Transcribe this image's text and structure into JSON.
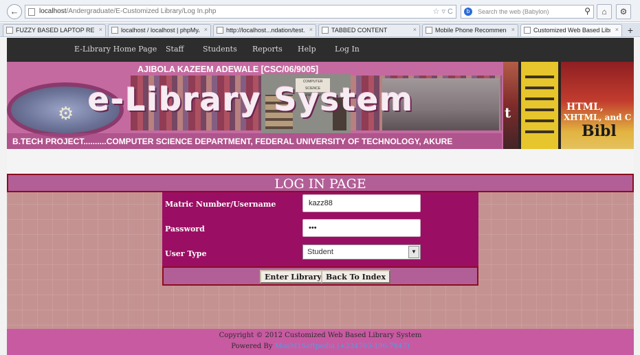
{
  "browser": {
    "url_host": "localhost",
    "url_path": "/Andergraduate/E-Customized Library/Log In.php",
    "search_placeholder": "Search the web (Babylon)",
    "addr_icons": "☆ ▿ C",
    "tabs": [
      {
        "title": "FUZZY BASED LAPTOP RECOMM...",
        "active": false
      },
      {
        "title": "localhost / localhost | phpMyAd...",
        "active": false
      },
      {
        "title": "http://localhost...ndation/test.php",
        "active": false
      },
      {
        "title": "TABBED CONTENT",
        "active": false
      },
      {
        "title": "Mobile Phone Recommender Sys...",
        "active": false
      },
      {
        "title": "Customized Web Based Library ...",
        "active": true
      }
    ],
    "new_tab_label": "+",
    "tab_close_glyph": "×"
  },
  "nav": {
    "items": [
      "E-Library Home Page",
      "Staff",
      "Students",
      "Reports",
      "Help",
      "Log In"
    ]
  },
  "banner": {
    "names": "AJIBOLA      KAZEEM      ADEWALE          [CSC/06/9005]",
    "title": "e-Library System",
    "subtitle": "B.TECH PROJECT..........COMPUTER SCIENCE DEPARTMENT, FEDERAL UNIVERSITY OF TECHNOLOGY, AKURE",
    "sign_text": "COMPUTER SCIENCE DEPARTMENT",
    "book_letter": "t",
    "book_html": "HTML,",
    "book_xhtml": "XHTML, and C",
    "book_bible": "Bibl"
  },
  "login": {
    "heading": "LOG IN PAGE",
    "username_label": "Matric Number/Username",
    "username_value": "kazz88",
    "password_label": "Password",
    "password_value": "•••",
    "usertype_label": "User Type",
    "usertype_value": "Student",
    "enter_button": "Enter Library",
    "back_button": "Back To Index"
  },
  "footer": {
    "copyright": "Copyright © 2012 Customized Web Based Library System",
    "powered_prefix": "Powered By ",
    "powered_link": "MooM1Softpedia (+234703-196-7847)"
  },
  "colors": {
    "nav_bg": "#2d2d2d",
    "heading_bg": "#b25f97",
    "form_bg": "#9a0f63",
    "content_bg": "#c59292",
    "footer_bg": "#c85aa2",
    "border_red": "#8b0d1e"
  }
}
